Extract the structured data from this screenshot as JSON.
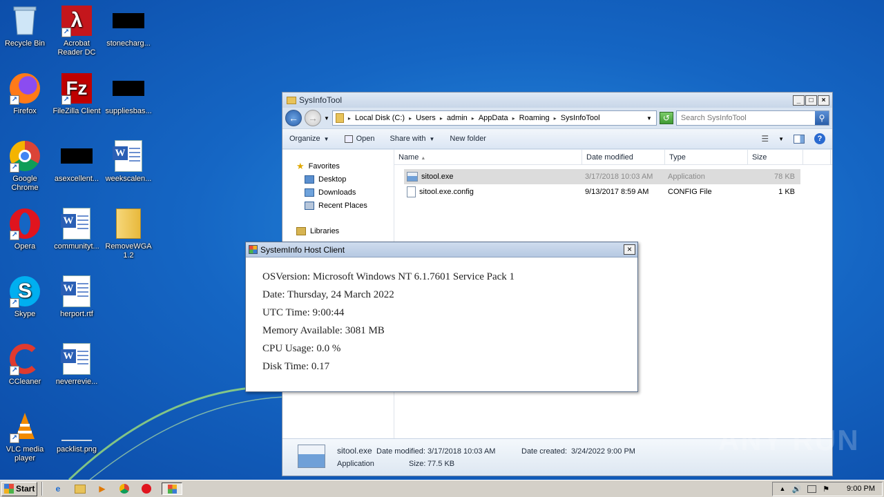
{
  "desktop": {
    "icons": [
      {
        "label": "Recycle Bin"
      },
      {
        "label": "Acrobat Reader DC"
      },
      {
        "label": "stonecharg..."
      },
      {
        "label": "Firefox"
      },
      {
        "label": "FileZilla Client"
      },
      {
        "label": "suppliesbas..."
      },
      {
        "label": "Google Chrome"
      },
      {
        "label": "asexcellent..."
      },
      {
        "label": "weekscalen..."
      },
      {
        "label": "Opera"
      },
      {
        "label": "communityt..."
      },
      {
        "label": "RemoveWGA 1.2"
      },
      {
        "label": "Skype"
      },
      {
        "label": "herport.rtf"
      },
      {
        "label": "CCleaner"
      },
      {
        "label": "neverrevie..."
      },
      {
        "label": "VLC media player"
      },
      {
        "label": "packlist.png"
      }
    ]
  },
  "explorer": {
    "title": "SysInfoTool",
    "breadcrumbs": [
      "Local Disk (C:)",
      "Users",
      "admin",
      "AppData",
      "Roaming",
      "SysInfoTool"
    ],
    "search_placeholder": "Search SysInfoTool",
    "toolbar": {
      "organize": "Organize",
      "open": "Open",
      "share_with": "Share with",
      "new_folder": "New folder"
    },
    "nav": {
      "favorites": "Favorites",
      "desktop": "Desktop",
      "downloads": "Downloads",
      "recent_places": "Recent Places",
      "libraries": "Libraries"
    },
    "columns": {
      "name": "Name",
      "date_modified": "Date modified",
      "type": "Type",
      "size": "Size"
    },
    "files": [
      {
        "name": "sitool.exe",
        "date": "3/17/2018 10:03 AM",
        "type": "Application",
        "size": "78 KB"
      },
      {
        "name": "sitool.exe.config",
        "date": "9/13/2017 8:59 AM",
        "type": "CONFIG File",
        "size": "1 KB"
      }
    ],
    "details": {
      "name": "sitool.exe",
      "modified_label": "Date modified:",
      "modified_value": "3/17/2018 10:03 AM",
      "created_label": "Date created:",
      "created_value": "3/24/2022 9:00 PM",
      "type": "Application",
      "size_label": "Size:",
      "size_value": "77.5 KB"
    }
  },
  "dialog": {
    "title": "SystemInfo Host Client",
    "lines": [
      "OSVersion: Microsoft Windows NT 6.1.7601 Service Pack 1",
      "Date: Thursday, 24 March 2022",
      "UTC Time: 9:00:44",
      "Memory Available: 3081 MB",
      "CPU Usage: 0.0 %",
      "Disk Time: 0.17"
    ]
  },
  "watermark": "ANY RUN",
  "taskbar": {
    "start": "Start",
    "clock": "9:00 PM"
  }
}
